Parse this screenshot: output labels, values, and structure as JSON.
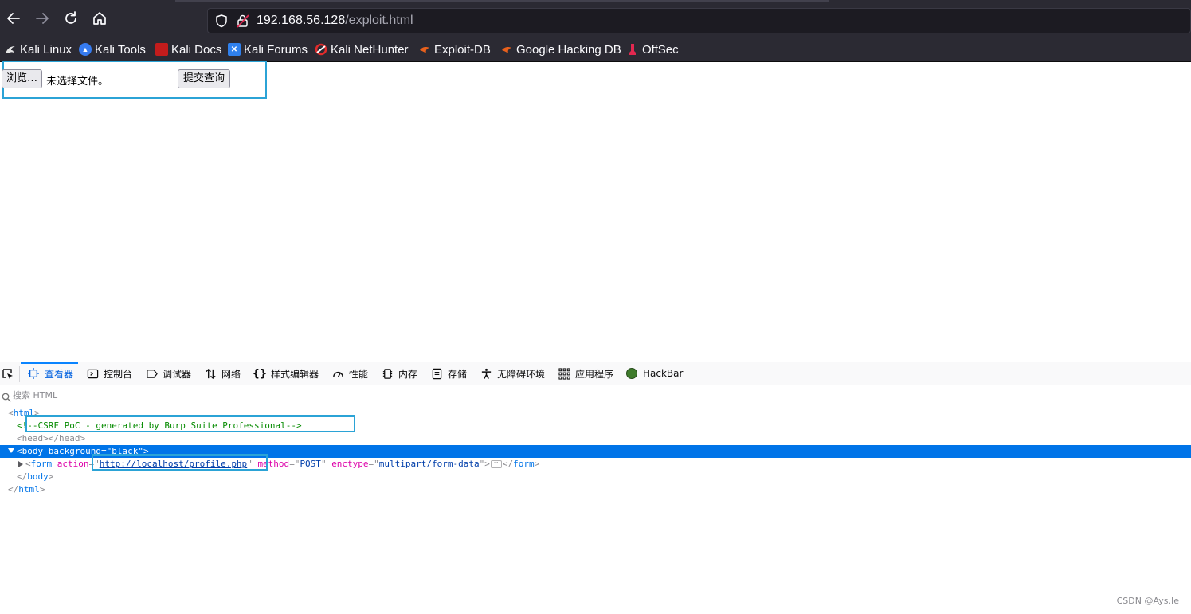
{
  "browser": {
    "url_host": "192.168.56.128",
    "url_path": "/exploit.html",
    "bookmarks": [
      {
        "label": "Kali Linux",
        "icon": "kali-dragon-icon"
      },
      {
        "label": "Kali Tools",
        "icon": "kali-tools-icon"
      },
      {
        "label": "Kali Docs",
        "icon": "kali-docs-icon"
      },
      {
        "label": "Kali Forums",
        "icon": "kali-forums-icon"
      },
      {
        "label": "Kali NetHunter",
        "icon": "kali-nethunter-icon"
      },
      {
        "label": "Exploit-DB",
        "icon": "exploit-db-icon"
      },
      {
        "label": "Google Hacking DB",
        "icon": "ghdb-icon"
      },
      {
        "label": "OffSec",
        "icon": "offsec-icon"
      }
    ]
  },
  "page": {
    "browse_label": "浏览…",
    "no_file_label": "未选择文件。",
    "submit_label": "提交查询"
  },
  "devtools": {
    "tabs": [
      {
        "label": "查看器",
        "icon": "inspector-icon",
        "active": true
      },
      {
        "label": "控制台",
        "icon": "console-icon"
      },
      {
        "label": "调试器",
        "icon": "debugger-icon"
      },
      {
        "label": "网络",
        "icon": "network-icon"
      },
      {
        "label": "样式编辑器",
        "icon": "style-editor-icon"
      },
      {
        "label": "性能",
        "icon": "performance-icon"
      },
      {
        "label": "内存",
        "icon": "memory-icon"
      },
      {
        "label": "存储",
        "icon": "storage-icon"
      },
      {
        "label": "无障碍环境",
        "icon": "accessibility-icon"
      },
      {
        "label": "应用程序",
        "icon": "application-icon"
      },
      {
        "label": "HackBar",
        "icon": "hackbar-icon"
      }
    ],
    "search_placeholder": "搜索 HTML",
    "markup": {
      "html_tag": "html",
      "comment": "<!--CSRF PoC - generated by Burp Suite Professional-->",
      "head": "<head></head>",
      "body_tag": "body",
      "body_attr": "background",
      "body_val": "black",
      "form_tag": "form",
      "form_action_attr": "action",
      "form_action": "http://localhost/profile.php",
      "form_method_attr": "method",
      "form_method": "POST",
      "form_enctype_attr": "enctype",
      "form_enctype": "multipart/form-data",
      "ellipsis": "⋯"
    }
  },
  "watermark": "CSDN @Ays.Ie"
}
